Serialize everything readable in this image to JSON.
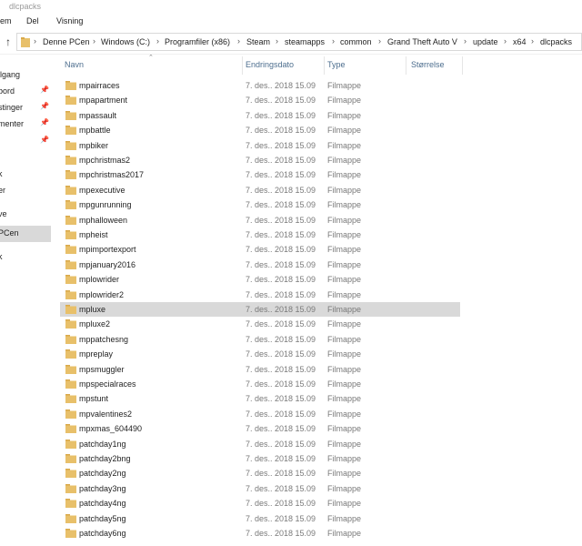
{
  "window": {
    "title": "dlcpacks"
  },
  "ribbon": {
    "tabs": [
      "em",
      "Del",
      "Visning"
    ]
  },
  "address": {
    "crumbs": [
      "Denne PCen",
      "Windows (C:)",
      "Programfiler (x86)",
      "Steam",
      "steamapps",
      "common",
      "Grand Theft Auto V",
      "update",
      "x64",
      "dlcpacks"
    ]
  },
  "nav": {
    "items": [
      {
        "label": "ilgang",
        "pinned": false
      },
      {
        "label": "bord",
        "pinned": true
      },
      {
        "label": "stinger",
        "pinned": true
      },
      {
        "label": "menter",
        "pinned": true
      },
      {
        "label": "",
        "pinned": true
      },
      {
        "label": "k",
        "pinned": false
      },
      {
        "label": "er",
        "pinned": false
      },
      {
        "label": "ve",
        "pinned": false
      },
      {
        "label": "PCen",
        "pinned": false,
        "selected": true
      },
      {
        "label": "k",
        "pinned": false
      }
    ]
  },
  "columns": {
    "name": "Navn",
    "date": "Endringsdato",
    "type": "Type",
    "size": "Størrelse"
  },
  "files": [
    {
      "name": "mpairraces",
      "date": "7. des.. 2018 15.09",
      "type": "Filmappe"
    },
    {
      "name": "mpapartment",
      "date": "7. des.. 2018 15.09",
      "type": "Filmappe"
    },
    {
      "name": "mpassault",
      "date": "7. des.. 2018 15.09",
      "type": "Filmappe"
    },
    {
      "name": "mpbattle",
      "date": "7. des.. 2018 15.09",
      "type": "Filmappe"
    },
    {
      "name": "mpbiker",
      "date": "7. des.. 2018 15.09",
      "type": "Filmappe"
    },
    {
      "name": "mpchristmas2",
      "date": "7. des.. 2018 15.09",
      "type": "Filmappe"
    },
    {
      "name": "mpchristmas2017",
      "date": "7. des.. 2018 15.09",
      "type": "Filmappe"
    },
    {
      "name": "mpexecutive",
      "date": "7. des.. 2018 15.09",
      "type": "Filmappe"
    },
    {
      "name": "mpgunrunning",
      "date": "7. des.. 2018 15.09",
      "type": "Filmappe"
    },
    {
      "name": "mphalloween",
      "date": "7. des.. 2018 15.09",
      "type": "Filmappe"
    },
    {
      "name": "mpheist",
      "date": "7. des.. 2018 15.09",
      "type": "Filmappe"
    },
    {
      "name": "mpimportexport",
      "date": "7. des.. 2018 15.09",
      "type": "Filmappe"
    },
    {
      "name": "mpjanuary2016",
      "date": "7. des.. 2018 15.09",
      "type": "Filmappe"
    },
    {
      "name": "mplowrider",
      "date": "7. des.. 2018 15.09",
      "type": "Filmappe"
    },
    {
      "name": "mplowrider2",
      "date": "7. des.. 2018 15.09",
      "type": "Filmappe"
    },
    {
      "name": "mpluxe",
      "date": "7. des.. 2018 15.09",
      "type": "Filmappe",
      "selected": true
    },
    {
      "name": "mpluxe2",
      "date": "7. des.. 2018 15.09",
      "type": "Filmappe"
    },
    {
      "name": "mppatchesng",
      "date": "7. des.. 2018 15.09",
      "type": "Filmappe"
    },
    {
      "name": "mpreplay",
      "date": "7. des.. 2018 15.09",
      "type": "Filmappe"
    },
    {
      "name": "mpsmuggler",
      "date": "7. des.. 2018 15.09",
      "type": "Filmappe"
    },
    {
      "name": "mpspecialraces",
      "date": "7. des.. 2018 15.09",
      "type": "Filmappe"
    },
    {
      "name": "mpstunt",
      "date": "7. des.. 2018 15.09",
      "type": "Filmappe"
    },
    {
      "name": "mpvalentines2",
      "date": "7. des.. 2018 15.09",
      "type": "Filmappe"
    },
    {
      "name": "mpxmas_604490",
      "date": "7. des.. 2018 15.09",
      "type": "Filmappe"
    },
    {
      "name": "patchday1ng",
      "date": "7. des.. 2018 15.09",
      "type": "Filmappe"
    },
    {
      "name": "patchday2bng",
      "date": "7. des.. 2018 15.09",
      "type": "Filmappe"
    },
    {
      "name": "patchday2ng",
      "date": "7. des.. 2018 15.09",
      "type": "Filmappe"
    },
    {
      "name": "patchday3ng",
      "date": "7. des.. 2018 15.09",
      "type": "Filmappe"
    },
    {
      "name": "patchday4ng",
      "date": "7. des.. 2018 15.09",
      "type": "Filmappe"
    },
    {
      "name": "patchday5ng",
      "date": "7. des.. 2018 15.09",
      "type": "Filmappe"
    },
    {
      "name": "patchday6ng",
      "date": "7. des.. 2018 15.09",
      "type": "Filmappe"
    }
  ],
  "colors": {
    "folder": "#e8c06a",
    "selection": "#d9d9d9",
    "header_text": "#4d6e8e"
  },
  "icons": {
    "folder": "folder-icon",
    "pin": "pin-icon",
    "up": "up-arrow-icon",
    "chevron": "chevron-right-icon"
  }
}
